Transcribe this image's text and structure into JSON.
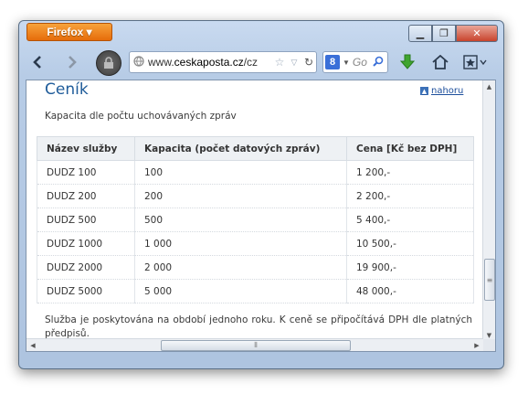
{
  "browser": {
    "menu_button_label": "Firefox ▾",
    "window_controls": {
      "minimize": "▁",
      "restore": "❐",
      "close": "✕"
    },
    "url_prefix": "www.",
    "url_host": "ceskaposta.cz",
    "url_rest": "/cz",
    "search_placeholder": "Go"
  },
  "page": {
    "heading": "Ceník",
    "top_link": "nahoru",
    "subtitle": "Kapacita dle počtu uchovávaných zpráv",
    "table": {
      "headers": [
        "Název služby",
        "Kapacita (počet datových zpráv)",
        "Cena [Kč bez DPH]"
      ],
      "rows": [
        [
          "DUDZ 100",
          "100",
          "1 200,-"
        ],
        [
          "DUDZ 200",
          "200",
          "2 200,-"
        ],
        [
          "DUDZ 500",
          "500",
          "5 400,-"
        ],
        [
          "DUDZ 1000",
          "1 000",
          "10 500,-"
        ],
        [
          "DUDZ 2000",
          "2 000",
          "19 900,-"
        ],
        [
          "DUDZ 5000",
          "5 000",
          "48 000,-"
        ]
      ]
    },
    "note": "Služba je poskytována na období jednoho roku. K ceně se připočítává DPH dle platných předpisů."
  },
  "colors": {
    "heading": "#1f5c9a",
    "firefox_button": "#e66c0a"
  },
  "icons": [
    "back-icon",
    "forward-icon",
    "padlock-icon",
    "globe-icon",
    "star-icon",
    "dropdown-icon",
    "reload-icon",
    "google-icon",
    "search-icon",
    "download-icon",
    "home-icon",
    "bookmarks-icon"
  ]
}
